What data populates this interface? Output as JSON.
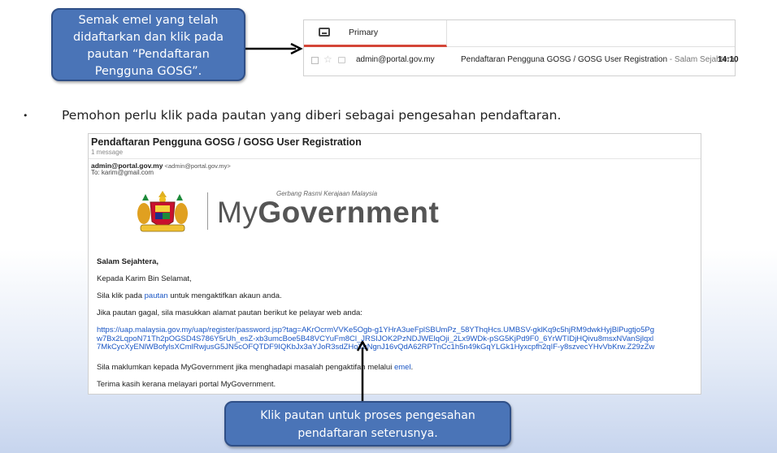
{
  "callout_top": {
    "lines": [
      "Semak emel yang telah",
      "didaftarkan dan klik pada",
      "pautan “Pendaftaran",
      "Pengguna GOSG”."
    ]
  },
  "gmail": {
    "tab_label": "Primary",
    "tab_icon": "inbox-icon",
    "sender": "admin@portal.gov.my",
    "subject": "Pendaftaran Pengguna GOSG / GOSG User Registration",
    "snippet": " - Salam Sejahtera,",
    "time": "14:10"
  },
  "bullet": {
    "symbol": "•",
    "text": "Pemohon perlu klik pada pautan yang diberi sebagai pengesahan pendaftaran."
  },
  "email": {
    "subject": "Pendaftaran Pengguna GOSG / GOSG User Registration",
    "message_count": "1 message",
    "from_name": "admin@portal.gov.my",
    "from_addr": " <admin@portal.gov.my>",
    "to": "To: karim@gmail.com",
    "logo_tagline": "Gerbang Rasmi Kerajaan Malaysia",
    "logo_my": "My",
    "logo_gov": "Government",
    "greeting": "Salam Sejahtera,",
    "p1": "Kepada Karim Bin Selamat,",
    "p2_before": "Sila klik pada ",
    "p2_link": "pautan",
    "p2_after": " untuk mengaktifkan akaun anda.",
    "p3": "Jika pautan gagal, sila masukkan alamat pautan berikut ke pelayar web anda:",
    "url_lines": [
      "https://uap.malaysia.gov.my/uap/register/password.jsp?tag=AKrOcrmVVKe5Ogb-g1YHrA3ueFplSBUmPz_58YThqHcs.UMBSV-gklKq9c5hjRM9dwkHyjBlPugtjo5Pg",
      "w7Bx2LqpoN71Th2pOGSD4S786Y5rUh_esZ-xb3umcBoe5B48VCYuFm8Cl_JRSIJOK2PzNDJWElqOji_2Lx9WDk-pSG5KjPd9F0_6YrWTIDjHQivu8msxNVanSjlqxl",
      "7MkCycXyENlWBofylsXCmlRwjusG5JN5cOFQTDF9IQKbJx3aYJoR3sdZHoYuNgnJ16vQdA62RPTnCc1h5n49kGqYLGk1Hyxcpfh2qIF-y8szvecYHvVbKrw.Z29zZw"
    ],
    "p4_before": "Sila maklumkan kepada MyGovernment jika menghadapi masalah pengaktifan melalui ",
    "p4_link": "emel",
    "p4_after": ".",
    "p5": "Terima kasih kerana melayari portal MyGovernment."
  },
  "callout_bottom": {
    "lines": [
      "Klik pautan untuk proses pengesahan",
      "pendaftaran seterusnya."
    ]
  }
}
